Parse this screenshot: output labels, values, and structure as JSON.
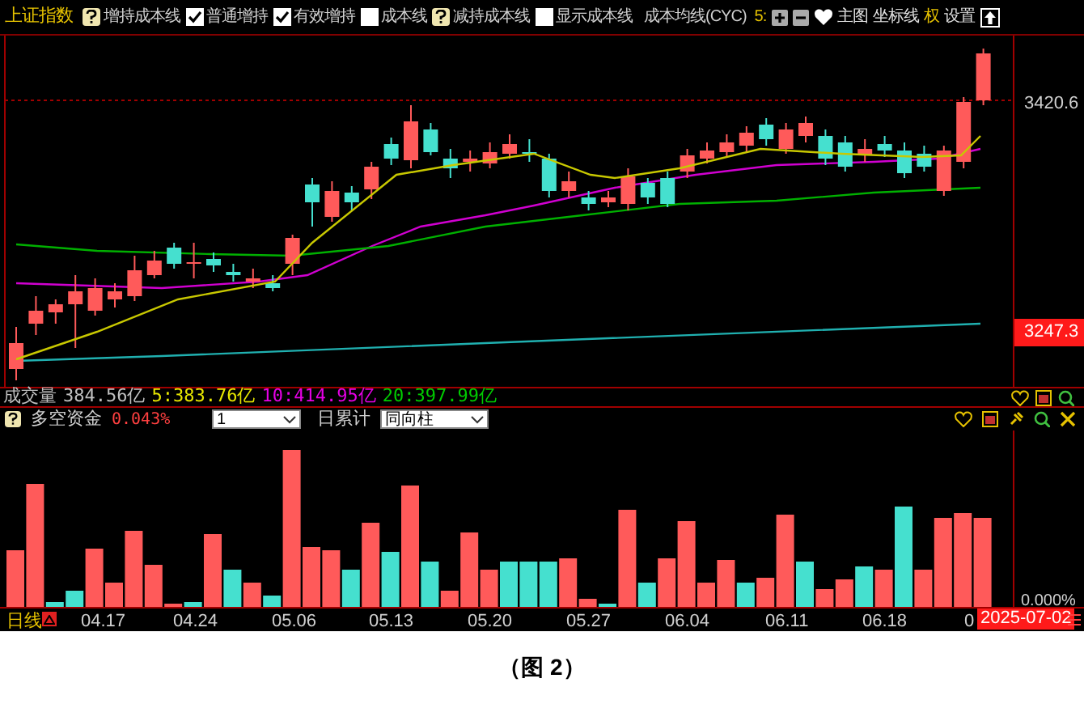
{
  "toolbar": {
    "title": "上证指数",
    "options": [
      {
        "kind": "help",
        "label": "增持成本线"
      },
      {
        "kind": "checkbox",
        "label": "普通增持",
        "checked": true
      },
      {
        "kind": "checkbox",
        "label": "有效增持",
        "checked": true
      },
      {
        "kind": "checkbox",
        "label": "成本线",
        "checked": false
      },
      {
        "kind": "help",
        "label": "减持成本线"
      },
      {
        "kind": "checkbox",
        "label": "显示成本线",
        "checked": false
      }
    ],
    "cyc_label": "成本均线(CYC)",
    "cyc_value": "5:",
    "menu": [
      {
        "label": "主图",
        "kind": "plain"
      },
      {
        "label": "坐标线",
        "kind": "plain"
      },
      {
        "label": "权",
        "kind": "accent"
      },
      {
        "label": "设置",
        "kind": "plain"
      }
    ]
  },
  "price_axis": {
    "upper": "3420.6",
    "lower": "3247.3"
  },
  "volume": {
    "label": "成交量",
    "value": "384.56亿",
    "averages": [
      {
        "text": "5:383.76亿",
        "color": "#e6e600"
      },
      {
        "text": "10:414.95亿",
        "color": "#e600e6"
      },
      {
        "text": "20:397.99亿",
        "color": "#00cc00"
      }
    ]
  },
  "indicator": {
    "name": "多空资金",
    "value": "0.043%",
    "period": "1",
    "accumulate_label": "日累计",
    "style": "同向柱",
    "axis_label": "0.000%"
  },
  "date_axis": {
    "period": "日线",
    "dates": [
      "04.17",
      "04.24",
      "05.06",
      "05.13",
      "05.20",
      "05.27",
      "06.04",
      "06.11",
      "06.18",
      "0"
    ],
    "current_date": "2025-07-02"
  },
  "caption": "（图 2）"
}
